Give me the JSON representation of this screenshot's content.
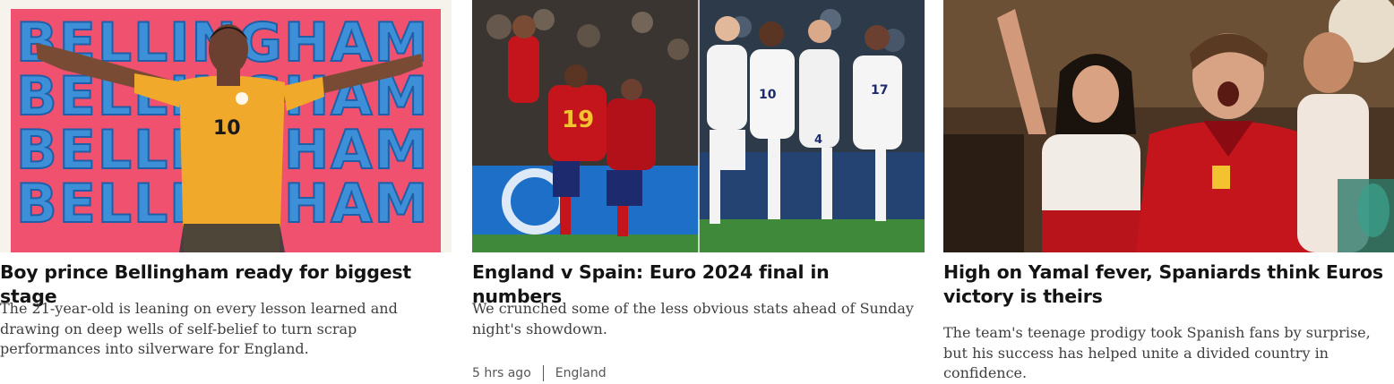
{
  "cards": [
    {
      "headline": "Boy prince Bellingham ready for biggest stage",
      "summary": "The 21-year-old is leaning on every lesson learned and drawing on deep wells of self-belief to turn scrap performances into silverware for England.",
      "image": {
        "icon": "player-arms-outstretched-artwork",
        "text_rows": [
          "BELLINGHAM",
          "BELLINGHAM",
          "BELLINGHAM",
          "BELLINGHAM"
        ],
        "shirt_number": "10"
      }
    },
    {
      "headline": "England v Spain: Euro 2024 final in numbers",
      "summary": "We crunched some of the less obvious stats ahead of Sunday night's showdown.",
      "meta": {
        "time": "5 hrs ago",
        "topic": "England"
      },
      "image": {
        "icon": "split-celebration-photo",
        "spain_number": "19",
        "england_numbers": [
          "10",
          "4",
          "17"
        ]
      }
    },
    {
      "headline": "High on Yamal fever, Spaniards think Euros victory is theirs",
      "summary": "The team's teenage prodigy took Spanish fans by surprise, but his success has helped unite a divided country in confidence.",
      "image": {
        "icon": "fans-celebrating-photo"
      }
    }
  ],
  "colors": {
    "pink": "#f0516f",
    "blue_letters": "#3d8fd8",
    "england_yellow": "#f0a92a",
    "spain_red": "#c4141c",
    "pitch_green": "#3f8a3a"
  }
}
